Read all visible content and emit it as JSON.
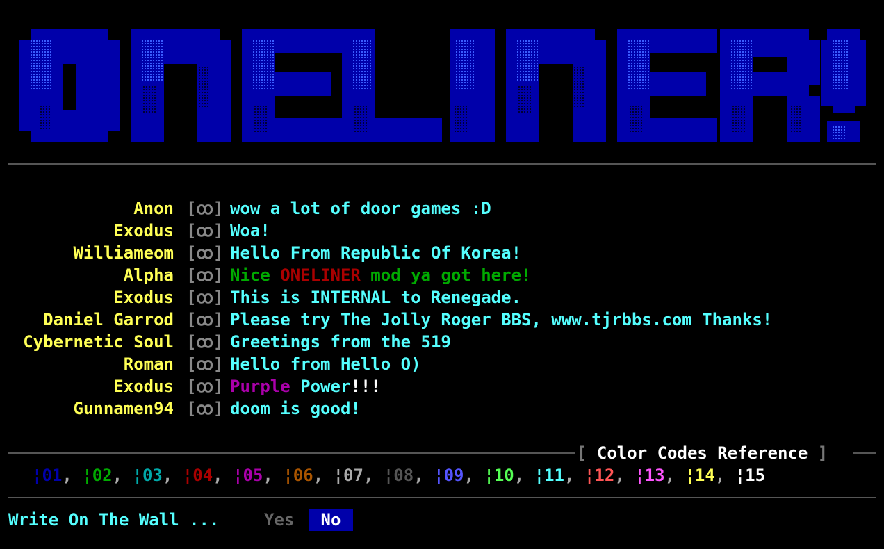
{
  "banner_text": "ONELINER!",
  "oneliners": [
    {
      "name": "Anon",
      "sep": "[ꝏ]",
      "message": [
        {
          "text": "wow a lot of door games :D",
          "color": "#55ffff"
        }
      ]
    },
    {
      "name": "Exodus",
      "sep": "[ꝏ]",
      "message": [
        {
          "text": "Woa!",
          "color": "#55ffff"
        }
      ]
    },
    {
      "name": "Williameom",
      "sep": "[ꝏ]",
      "message": [
        {
          "text": "Hello From Republic Of Korea!",
          "color": "#55ffff"
        }
      ]
    },
    {
      "name": "Alpha",
      "sep": "[ꝏ]",
      "message": [
        {
          "text": "Nice ",
          "color": "#00aa00"
        },
        {
          "text": "ONELINER",
          "color": "#aa0000"
        },
        {
          "text": " mod ya got here!",
          "color": "#00aa00"
        }
      ]
    },
    {
      "name": "Exodus",
      "sep": "[ꝏ]",
      "message": [
        {
          "text": "This is INTERNAL to Renegade.",
          "color": "#55ffff"
        }
      ]
    },
    {
      "name": "Daniel Garrod",
      "sep": "[ꝏ]",
      "message": [
        {
          "text": "Please try The Jolly Roger BBS, www.tjrbbs.com Thanks!",
          "color": "#55ffff"
        }
      ]
    },
    {
      "name": "Cybernetic Soul",
      "sep": "[ꝏ]",
      "message": [
        {
          "text": "Greetings from the 519",
          "color": "#55ffff"
        }
      ]
    },
    {
      "name": "Roman",
      "sep": "[ꝏ]",
      "message": [
        {
          "text": "Hello from Hello O)",
          "color": "#55ffff"
        }
      ]
    },
    {
      "name": "Exodus",
      "sep": "[ꝏ]",
      "message": [
        {
          "text": "Purple",
          "color": "#aa00aa"
        },
        {
          "text": " Power",
          "color": "#55ffff"
        },
        {
          "text": "!!!",
          "color": "#ffffff"
        }
      ]
    },
    {
      "name": "Gunnamen94",
      "sep": "[ꝏ]",
      "message": [
        {
          "text": "doom is good!",
          "color": "#55ffff"
        }
      ]
    }
  ],
  "reference": {
    "open_bracket": "[",
    "title": "Color Codes Reference",
    "close_bracket": "]"
  },
  "color_codes": [
    {
      "code": "¦01",
      "color": "#0000aa"
    },
    {
      "code": "¦02",
      "color": "#00aa00"
    },
    {
      "code": "¦03",
      "color": "#00aaaa"
    },
    {
      "code": "¦04",
      "color": "#aa0000"
    },
    {
      "code": "¦05",
      "color": "#aa00aa"
    },
    {
      "code": "¦06",
      "color": "#aa5500"
    },
    {
      "code": "¦07",
      "color": "#aaaaaa"
    },
    {
      "code": "¦08",
      "color": "#555555"
    },
    {
      "code": "¦09",
      "color": "#5555ff"
    },
    {
      "code": "¦10",
      "color": "#55ff55"
    },
    {
      "code": "¦11",
      "color": "#55ffff"
    },
    {
      "code": "¦12",
      "color": "#ff5555"
    },
    {
      "code": "¦13",
      "color": "#ff55ff"
    },
    {
      "code": "¦14",
      "color": "#ffff55"
    },
    {
      "code": "¦15",
      "color": "#ffffff"
    }
  ],
  "code_separator": ", ",
  "prompt": {
    "text": "Write On The Wall ...",
    "yes": "Yes",
    "no": "No"
  }
}
